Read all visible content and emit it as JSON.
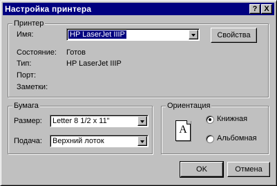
{
  "window": {
    "title": "Настройка принтера",
    "help_button": "?",
    "close_button": "X"
  },
  "printer": {
    "group_label": "Принтер",
    "name_label": "Имя:",
    "name_value": "HP LaserJet IIIP",
    "properties_button": "Свойства",
    "status_label": "Состояние:",
    "status_value": "Готов",
    "type_label": "Тип:",
    "type_value": "HP LaserJet IIIP",
    "port_label": "Порт:",
    "port_value": "",
    "comment_label": "Заметки:",
    "comment_value": ""
  },
  "paper": {
    "group_label": "Бумага",
    "size_label": "Размер:",
    "size_value": "Letter 8 1/2 x 11\"",
    "source_label": "Подача:",
    "source_value": "Верхний лоток"
  },
  "orientation": {
    "group_label": "Ориентация",
    "page_icon_letter": "A",
    "portrait_label": "Книжная",
    "landscape_label": "Альбомная",
    "selected": "portrait"
  },
  "buttons": {
    "ok": "OK",
    "cancel": "Отмена"
  },
  "colors": {
    "titlebar": "#000080",
    "face": "#c0c0c0",
    "selection": "#000080"
  }
}
